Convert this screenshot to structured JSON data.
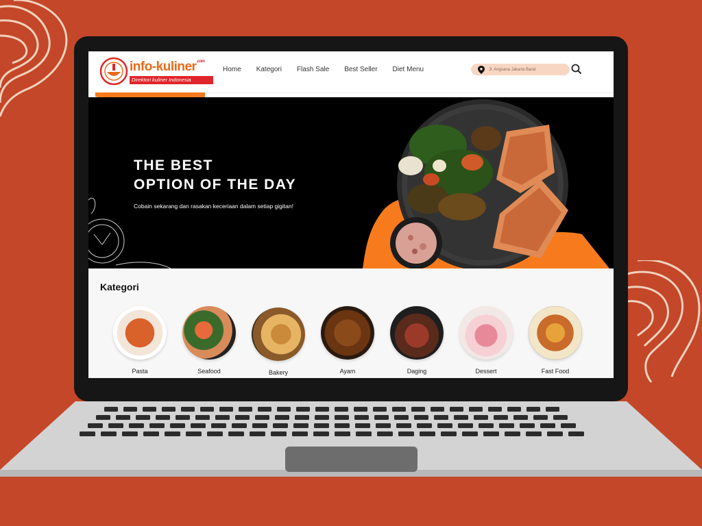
{
  "brand": {
    "name": "info-kuliner",
    "suffix": ".com",
    "tagline": "Direktori kuliner Indonesia"
  },
  "nav": {
    "items": [
      "Home",
      "Kategori",
      "Flash Sale",
      "Best Seller",
      "Diet Menu"
    ]
  },
  "location": {
    "value": "Jl. Angsana Jakarta Barat"
  },
  "hero": {
    "title_line1": "THE BEST",
    "title_line2": "OPTION OF THE DAY",
    "subtitle": "Cobain sekarang dan rasakan keceriaan dalam setiap gigitan!"
  },
  "kategori": {
    "title": "Kategori",
    "items": [
      {
        "label": "Pasta",
        "icon": "pasta-image"
      },
      {
        "label": "Seafood",
        "icon": "seafood-image"
      },
      {
        "label": "Bakery",
        "icon": "bakery-image"
      },
      {
        "label": "Ayam",
        "icon": "ayam-image"
      },
      {
        "label": "Daging",
        "icon": "daging-image"
      },
      {
        "label": "Dessert",
        "icon": "dessert-image"
      },
      {
        "label": "Fast Food",
        "icon": "fastfood-image"
      }
    ]
  },
  "colors": {
    "background": "#c4472a",
    "accent_orange": "#f77b1c",
    "brand_red": "#e0262b",
    "location_pill": "#f8d6c4"
  }
}
